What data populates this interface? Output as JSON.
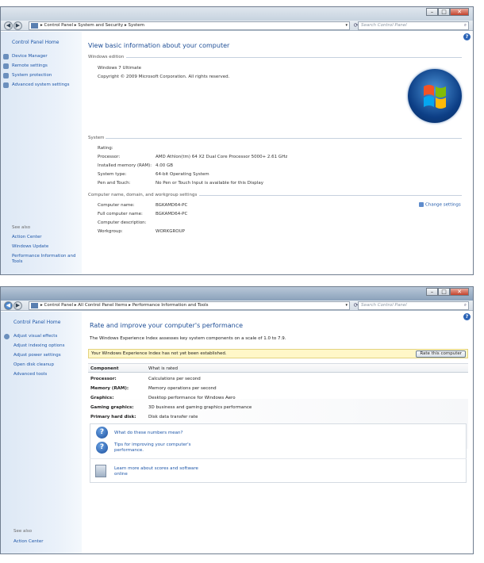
{
  "window1": {
    "breadcrumb": [
      "Control Panel",
      "System and Security",
      "System"
    ],
    "search_placeholder": "Search Control Panel",
    "sidebar": {
      "home": "Control Panel Home",
      "items": [
        "Device Manager",
        "Remote settings",
        "System protection",
        "Advanced system settings"
      ],
      "see_also_label": "See also",
      "see_also": [
        "Action Center",
        "Windows Update",
        "Performance Information and Tools"
      ]
    },
    "main": {
      "title": "View basic information about your computer",
      "edition_heading": "Windows edition",
      "edition_name": "Windows 7 Ultimate",
      "copyright": "Copyright © 2009 Microsoft Corporation.  All rights reserved.",
      "system_heading": "System",
      "system_rows": [
        {
          "label": "Rating:",
          "value": ""
        },
        {
          "label": "Processor:",
          "value": "AMD Athlon(tm) 64 X2 Dual Core Processor 5000+   2.61 GHz"
        },
        {
          "label": "Installed memory (RAM):",
          "value": "4.00 GB"
        },
        {
          "label": "System type:",
          "value": "64-bit Operating System"
        },
        {
          "label": "Pen and Touch:",
          "value": "No Pen or Touch Input is available for this Display"
        }
      ],
      "computer_heading": "Computer name, domain, and workgroup settings",
      "computer_rows": [
        {
          "label": "Computer name:",
          "value": "BGKAMD64-PC"
        },
        {
          "label": "Full computer name:",
          "value": "BGKAMD64-PC"
        },
        {
          "label": "Computer description:",
          "value": ""
        },
        {
          "label": "Workgroup:",
          "value": "WORKGROUP"
        }
      ],
      "change_settings": "Change settings"
    }
  },
  "window2": {
    "breadcrumb": [
      "Control Panel",
      "All Control Panel Items",
      "Performance Information and Tools"
    ],
    "search_placeholder": "Search Control Panel",
    "sidebar": {
      "home": "Control Panel Home",
      "items": [
        "Adjust visual effects",
        "Adjust indexing options",
        "Adjust power settings",
        "Open disk cleanup",
        "Advanced tools"
      ],
      "see_also_label": "See also",
      "see_also": [
        "Action Center"
      ]
    },
    "main": {
      "title": "Rate and improve your computer's performance",
      "description": "The Windows Experience Index assesses key system components on a scale of 1.0 to 7.9.",
      "notice": "Your Windows Experience Index has not yet been established.",
      "rate_button": "Rate this computer",
      "table_headers": [
        "Component",
        "What is rated"
      ],
      "table_rows": [
        {
          "component": "Processor:",
          "rated": "Calculations per second"
        },
        {
          "component": "Memory (RAM):",
          "rated": "Memory operations per second"
        },
        {
          "component": "Graphics:",
          "rated": "Desktop performance for Windows Aero"
        },
        {
          "component": "Gaming graphics:",
          "rated": "3D business and gaming graphics performance"
        },
        {
          "component": "Primary hard disk:",
          "rated": "Disk data transfer rate"
        }
      ],
      "help_links": [
        "What do these numbers mean?",
        "Tips for improving your computer's",
        "performance."
      ],
      "learn_more": [
        "Learn more about scores and software",
        "online"
      ]
    }
  },
  "colors": {
    "link": "#1d56a8",
    "title": "#1e4e96",
    "sidebar": "#dde8f5",
    "notice_bg": "#fff7c8"
  },
  "icons": [
    "back-icon",
    "forward-icon",
    "refresh-icon",
    "search-icon",
    "help-icon",
    "windows-logo-icon",
    "shield-icon",
    "question-icon"
  ]
}
